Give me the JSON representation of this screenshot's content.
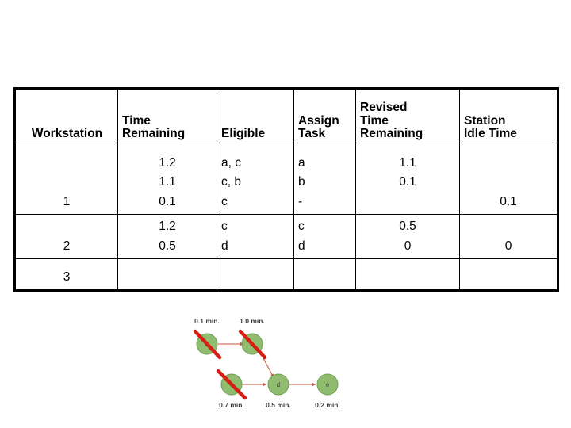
{
  "table": {
    "headers": [
      {
        "label": "Workstation",
        "align": "center"
      },
      {
        "label": "Time\nRemaining",
        "align": "left"
      },
      {
        "label": "Eligible",
        "align": "left"
      },
      {
        "label": "Assign\nTask",
        "align": "left"
      },
      {
        "label": "Revised\nTime\nRemaining",
        "align": "left"
      },
      {
        "label": "Station\nIdle Time",
        "align": "left"
      }
    ],
    "rows": [
      {
        "workstation": "1",
        "time_remaining": "1.2\n1.1\n0.1",
        "eligible": "a, c\nc, b\nc",
        "assign_task": "a\nb\n-",
        "revised_time_remaining": "1.1\n0.1\n",
        "station_idle_time": "\n\n0.1"
      },
      {
        "workstation": "2",
        "time_remaining": "1.2\n0.5",
        "eligible": "c\nd",
        "assign_task": "c\nd",
        "revised_time_remaining": "0.5\n0",
        "station_idle_time": "\n0"
      },
      {
        "workstation": "3",
        "time_remaining": "",
        "eligible": "",
        "assign_task": "",
        "revised_time_remaining": "",
        "station_idle_time": ""
      }
    ]
  },
  "diagram": {
    "type": "precedence-network",
    "node_fill": "#8fbc6e",
    "node_stroke": "#6f9e52",
    "arrow_color": "#c0563f",
    "strike_color": "#d61f14",
    "nodes": [
      {
        "id": "a",
        "label": "a",
        "time_label": "0.1 min.",
        "time_label_position": "top",
        "struck": true
      },
      {
        "id": "b",
        "label": "b",
        "time_label": "1.0 min.",
        "time_label_position": "top",
        "struck": true
      },
      {
        "id": "c",
        "label": "c",
        "time_label": "0.7 min.",
        "time_label_position": "bottom",
        "struck": true
      },
      {
        "id": "d",
        "label": "d",
        "time_label": "0.5 min.",
        "time_label_position": "bottom",
        "struck": false
      },
      {
        "id": "e",
        "label": "e",
        "time_label": "0.2 min.",
        "time_label_position": "bottom",
        "struck": false
      }
    ],
    "edges": [
      {
        "from": "a",
        "to": "b"
      },
      {
        "from": "b",
        "to": "d"
      },
      {
        "from": "c",
        "to": "d"
      },
      {
        "from": "d",
        "to": "e"
      }
    ]
  }
}
